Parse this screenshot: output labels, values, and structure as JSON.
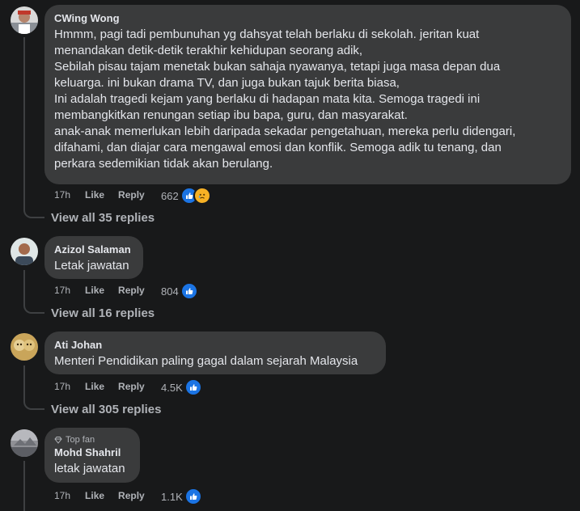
{
  "comments": [
    {
      "author": "CWing Wong",
      "text": [
        "Hmmm, pagi tadi pembunuhan yg dahsyat telah berlaku di sekolah. jeritan kuat",
        "menandakan detik-detik terakhir kehidupan seorang adik,",
        "Sebilah pisau tajam menetak bukan sahaja nyawanya, tetapi juga masa depan dua",
        "keluarga. ini bukan drama TV, dan juga bukan tajuk berita biasa,",
        "Ini adalah tragedi kejam yang berlaku di hadapan mata kita. Semoga tragedi ini",
        "membangkitkan renungan setiap ibu bapa, guru, dan masyarakat.",
        "anak-anak memerlukan lebih daripada sekadar pengetahuan, mereka perlu didengari,",
        "difahami, dan diajar cara mengawal emosi dan konflik. Semoga adik tu tenang, dan",
        "perkara sedemikian tidak akan berulang."
      ],
      "time": "17h",
      "like_label": "Like",
      "reply_label": "Reply",
      "reactions": "662",
      "reaction_icons": [
        "like-icon",
        "sad-icon"
      ],
      "view_replies": "View all 35 replies"
    },
    {
      "author": "Azizol Salaman",
      "text": [
        "Letak jawatan"
      ],
      "time": "17h",
      "like_label": "Like",
      "reply_label": "Reply",
      "reactions": "804",
      "reaction_icons": [
        "like-icon"
      ],
      "view_replies": "View all 16 replies"
    },
    {
      "author": "Ati Johan",
      "text": [
        "Menteri Pendidikan paling gagal dalam sejarah Malaysia"
      ],
      "time": "17h",
      "like_label": "Like",
      "reply_label": "Reply",
      "reactions": "4.5K",
      "reaction_icons": [
        "like-icon"
      ],
      "view_replies": "View all 305 replies"
    },
    {
      "badge": "Top fan",
      "author": "Mohd Shahril",
      "text": [
        "letak jawatan"
      ],
      "time": "17h",
      "like_label": "Like",
      "reply_label": "Reply",
      "reactions": "1.1K",
      "reaction_icons": [
        "like-icon"
      ]
    }
  ],
  "colors": {
    "background": "#18191a",
    "bubble": "#3a3b3c",
    "like_blue": "#1b74e4",
    "sad_yellow": "#f7b125",
    "secondary_text": "#b0b3b8"
  }
}
